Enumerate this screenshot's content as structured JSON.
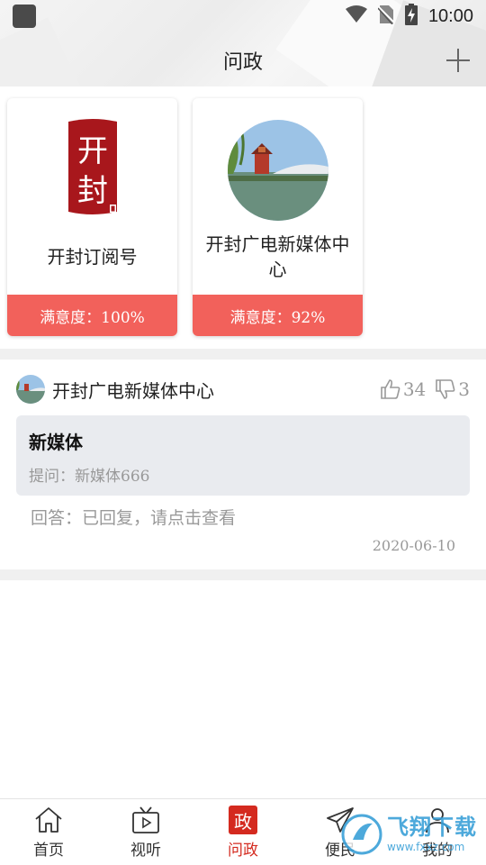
{
  "status_bar": {
    "time": "10:00"
  },
  "header": {
    "title": "问政"
  },
  "cards": [
    {
      "name": "开封订阅号",
      "satisfaction": "满意度：100%"
    },
    {
      "name": "开封广电新媒体中心",
      "satisfaction": "满意度：92%"
    }
  ],
  "logo_text": "开封",
  "post": {
    "author": "开封广电新媒体中心",
    "likes": "34",
    "dislikes": "3",
    "question_title": "新媒体",
    "question_text": "提问：新媒体666",
    "answer": "回答：已回复，请点击查看",
    "date": "2020-06-10"
  },
  "bottom_nav": {
    "items": [
      {
        "label": "首页",
        "icon": "home-icon"
      },
      {
        "label": "视听",
        "icon": "tv-icon"
      },
      {
        "label": "问政",
        "icon": "gov-icon",
        "icon_text": "政",
        "active": true
      },
      {
        "label": "便民",
        "icon": "paper-plane-icon"
      },
      {
        "label": "我的",
        "icon": "user-icon"
      }
    ]
  },
  "watermark": {
    "brand": "飞翔下载",
    "url": "www.fxxz.com"
  },
  "colors": {
    "accent": "#f2615b",
    "nav_active": "#d42a1f"
  }
}
